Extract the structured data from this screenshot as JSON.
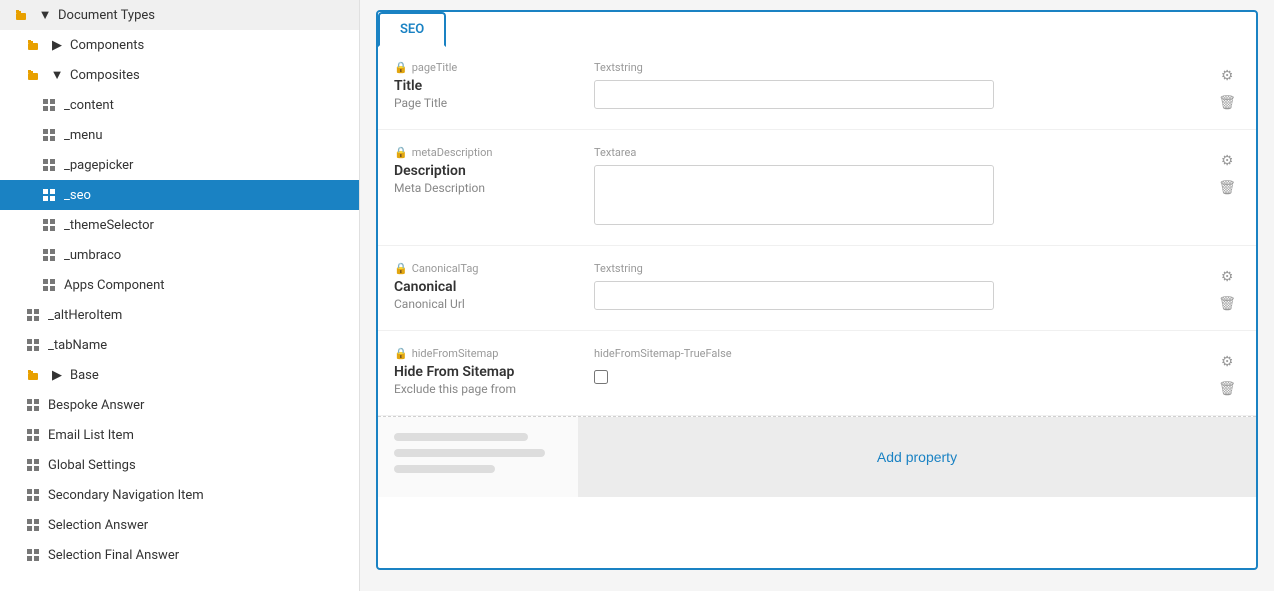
{
  "sidebar": {
    "items": [
      {
        "id": "document-types",
        "label": "Document Types",
        "level": 0,
        "type": "folder-open",
        "indent": 0
      },
      {
        "id": "components",
        "label": "Components",
        "level": 1,
        "type": "folder-closed",
        "indent": 1
      },
      {
        "id": "composites",
        "label": "Composites",
        "level": 1,
        "type": "folder-open",
        "indent": 1
      },
      {
        "id": "_content",
        "label": "_content",
        "level": 2,
        "type": "grid",
        "indent": 2
      },
      {
        "id": "_menu",
        "label": "_menu",
        "level": 2,
        "type": "grid",
        "indent": 2
      },
      {
        "id": "_pagepicker",
        "label": "_pagepicker",
        "level": 2,
        "type": "grid",
        "indent": 2
      },
      {
        "id": "_seo",
        "label": "_seo",
        "level": 2,
        "type": "grid",
        "indent": 2,
        "active": true
      },
      {
        "id": "_themeSelector",
        "label": "_themeSelector",
        "level": 2,
        "type": "grid",
        "indent": 2
      },
      {
        "id": "_umbraco",
        "label": "_umbraco",
        "level": 2,
        "type": "grid",
        "indent": 2
      },
      {
        "id": "apps-component",
        "label": "Apps Component",
        "level": 2,
        "type": "grid",
        "indent": 2
      },
      {
        "id": "_altHeroItem",
        "label": "_altHeroItem",
        "level": 1,
        "type": "grid",
        "indent": 1
      },
      {
        "id": "_tabName",
        "label": "_tabName",
        "level": 1,
        "type": "grid",
        "indent": 1
      },
      {
        "id": "base",
        "label": "Base",
        "level": 1,
        "type": "folder-closed",
        "indent": 1
      },
      {
        "id": "bespoke-answer",
        "label": "Bespoke Answer",
        "level": 1,
        "type": "grid",
        "indent": 1
      },
      {
        "id": "email-list-item",
        "label": "Email List Item",
        "level": 1,
        "type": "grid",
        "indent": 1
      },
      {
        "id": "global-settings",
        "label": "Global Settings",
        "level": 1,
        "type": "grid",
        "indent": 1
      },
      {
        "id": "secondary-navigation-item",
        "label": "Secondary Navigation Item",
        "level": 1,
        "type": "grid",
        "indent": 1
      },
      {
        "id": "selection-answer",
        "label": "Selection Answer",
        "level": 1,
        "type": "grid",
        "indent": 1
      },
      {
        "id": "selection-final-answer",
        "label": "Selection Final Answer",
        "level": 1,
        "type": "grid",
        "indent": 1
      }
    ]
  },
  "tabs": [
    {
      "id": "seo",
      "label": "SEO",
      "active": true
    }
  ],
  "properties": [
    {
      "id": "pageTitle",
      "alias": "pageTitle",
      "name": "Title",
      "description": "Page Title",
      "type": "Textstring",
      "inputType": "text",
      "locked": true
    },
    {
      "id": "metaDescription",
      "alias": "metaDescription",
      "name": "Description",
      "description": "Meta Description",
      "type": "Textarea",
      "inputType": "textarea",
      "locked": true
    },
    {
      "id": "canonicalTag",
      "alias": "CanonicalTag",
      "name": "Canonical",
      "description": "Canonical Url",
      "type": "Textstring",
      "inputType": "text",
      "locked": true
    },
    {
      "id": "hideFromSitemap",
      "alias": "hideFromSitemap",
      "name": "Hide From Sitemap",
      "description": "Exclude this page from",
      "type": "hideFromSitemap-TrueFalse",
      "inputType": "checkbox",
      "locked": true
    }
  ],
  "actions": {
    "gear_label": "⚙",
    "delete_label": "🗑"
  },
  "add_property_label": "Add property"
}
